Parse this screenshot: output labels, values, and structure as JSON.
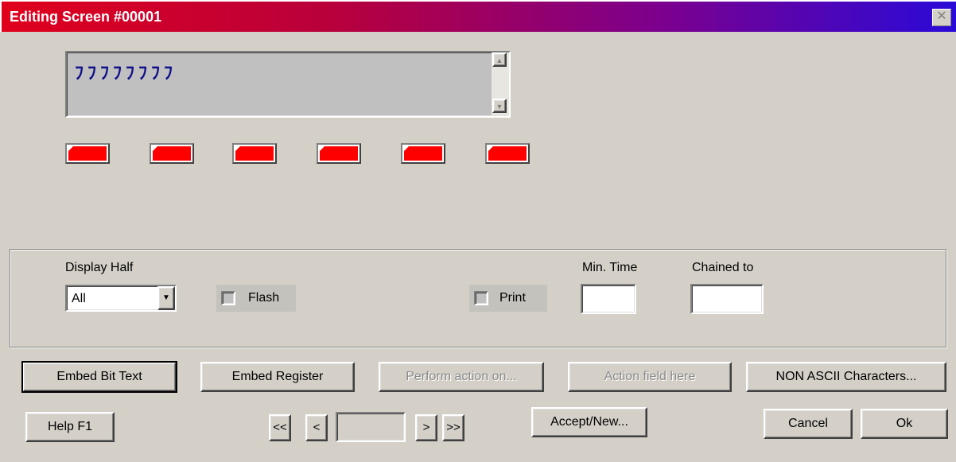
{
  "window": {
    "title": "Editing Screen #00001",
    "close_glyph": "✕"
  },
  "editor": {
    "text": "ﾌﾌﾌﾌﾌﾌﾌﾌ",
    "scroll_up_glyph": "▲",
    "scroll_down_glyph": "▼"
  },
  "indicators": [
    {
      "color": "#ff0000"
    },
    {
      "color": "#ff0000"
    },
    {
      "color": "#ff0000"
    },
    {
      "color": "#ff0000"
    },
    {
      "color": "#ff0000"
    },
    {
      "color": "#ff0000"
    }
  ],
  "options": {
    "display_half_label": "Display Half",
    "display_half_value": "All",
    "dropdown_glyph": "▼",
    "flash_label": "Flash",
    "print_label": "Print",
    "min_time_label": "Min. Time",
    "min_time_value": "",
    "chained_to_label": "Chained to",
    "chained_to_value": ""
  },
  "actions": {
    "embed_bit_text": "Embed Bit Text",
    "embed_register": "Embed Register",
    "perform_action_on": "Perform action on...",
    "action_field_here": "Action field here",
    "non_ascii": "NON ASCII Characters..."
  },
  "footer": {
    "help": "Help F1",
    "nav_first": "<<",
    "nav_prev": "<",
    "nav_value": "",
    "nav_next": ">",
    "nav_last": ">>",
    "accept_new": "Accept/New...",
    "cancel": "Cancel",
    "ok": "Ok"
  }
}
